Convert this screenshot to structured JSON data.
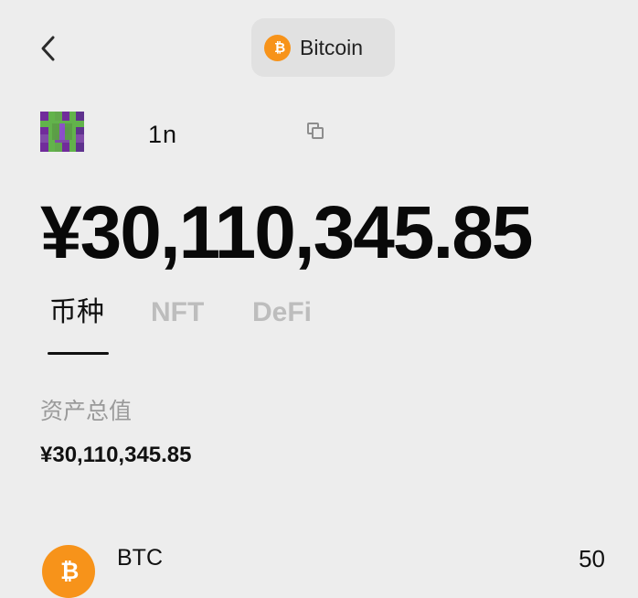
{
  "header": {
    "network": {
      "name": "Bitcoin",
      "icon": "bitcoin-icon",
      "color": "#f7931a"
    }
  },
  "wallet": {
    "avatar": "avatar",
    "address": "1n"
  },
  "balance": {
    "amount": "¥30,110,345.85"
  },
  "tabs": [
    {
      "label": "币种",
      "active": true
    },
    {
      "label": "NFT",
      "active": false
    },
    {
      "label": "DeFi",
      "active": false
    }
  ],
  "assets": {
    "total_label": "资产总值",
    "total_value": "¥30,110,345.85",
    "items": [
      {
        "symbol": "BTC",
        "amount": "50",
        "icon": "bitcoin-icon",
        "color": "#f7931a"
      }
    ]
  }
}
